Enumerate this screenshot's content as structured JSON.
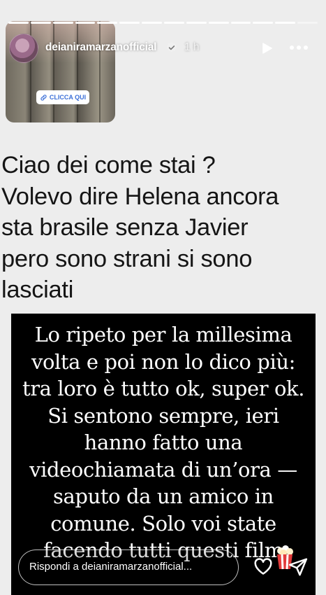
{
  "story": {
    "progress_segments": 14,
    "progress_done": 13,
    "username": "deianiramarzanofficial",
    "time_ago": "1 h",
    "thumbnail": {
      "link_sticker_label": "CLICCA QUI"
    },
    "message": "Ciao dei come stai ?\nVolevo dire Helena ancora\nsta brasile senza Javier\npero sono strani  si sono\nlasciati",
    "reply_text": "Lo ripeto per la millesima\nvolta e poi non lo dico più:\ntra loro è tutto ok, super ok.\nSi sentono sempre, ieri\nhanno fatto una\nvideochiamata di un’ora —\nsaputo da un amico in\ncomune. Solo voi state\nfacendo tutti questi film"
  },
  "footer": {
    "reply_placeholder": "Rispondi a deianiramarzanofficial..."
  },
  "icons": {
    "verified": "verified-badge-icon",
    "play": "play-icon",
    "more": "more-options-icon",
    "heart": "heart-icon",
    "send": "send-icon",
    "popcorn": "popcorn-emoji-icon",
    "link": "link-icon"
  },
  "colors": {
    "card_background": "#ededed",
    "reply_background": "#000000",
    "verified_badge": "#3897f0",
    "link_sticker_text": "#3b6fd8"
  }
}
